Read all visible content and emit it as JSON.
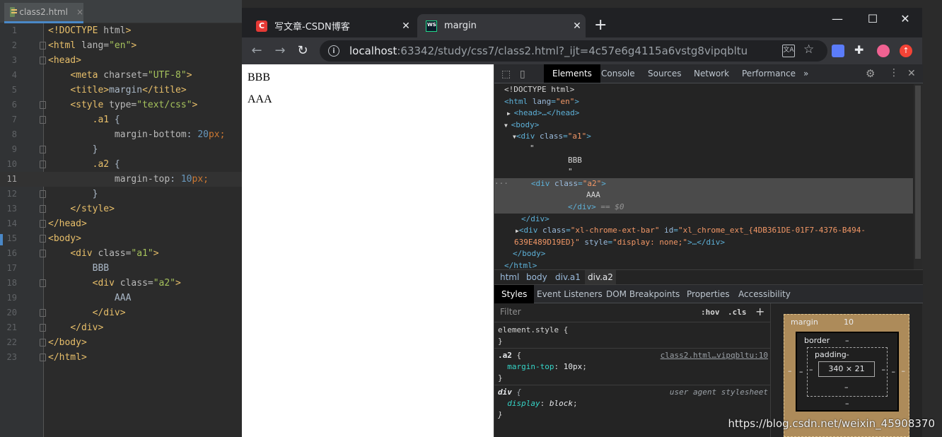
{
  "ide": {
    "tab_label": "class2.html",
    "close_glyph": "×",
    "current_line": 11,
    "lines": [
      {
        "n": "1",
        "segs": [
          [
            "tag",
            "<!DOCTYPE "
          ],
          [
            "attr",
            "html"
          ],
          [
            "tag",
            ">"
          ]
        ]
      },
      {
        "n": "2",
        "segs": [
          [
            "tag",
            "<html "
          ],
          [
            "attr",
            "lang"
          ],
          [
            "attr",
            "="
          ],
          [
            "str",
            "\"en\""
          ],
          [
            "tag",
            ">"
          ]
        ]
      },
      {
        "n": "3",
        "segs": [
          [
            "tag",
            "<head>"
          ]
        ]
      },
      {
        "n": "4",
        "segs": [
          [
            "plain",
            "    "
          ],
          [
            "tag",
            "<meta "
          ],
          [
            "attr",
            "charset"
          ],
          [
            "attr",
            "="
          ],
          [
            "str",
            "\"UTF-8\""
          ],
          [
            "tag",
            ">"
          ]
        ]
      },
      {
        "n": "5",
        "segs": [
          [
            "plain",
            "    "
          ],
          [
            "tag",
            "<title>"
          ],
          [
            "plain",
            "margin"
          ],
          [
            "tag",
            "</title>"
          ]
        ]
      },
      {
        "n": "6",
        "segs": [
          [
            "plain",
            "    "
          ],
          [
            "tag",
            "<style "
          ],
          [
            "attr",
            "type"
          ],
          [
            "attr",
            "="
          ],
          [
            "str",
            "\"text/css\""
          ],
          [
            "tag",
            ">"
          ]
        ]
      },
      {
        "n": "7",
        "segs": [
          [
            "plain",
            "        "
          ],
          [
            "sel",
            ".a1"
          ],
          [
            "plain",
            " {"
          ]
        ]
      },
      {
        "n": "8",
        "segs": [
          [
            "plain",
            "            "
          ],
          [
            "prop",
            "margin-bottom"
          ],
          [
            "plain",
            ": "
          ],
          [
            "num",
            "20"
          ],
          [
            "unit",
            "px"
          ],
          [
            "punc",
            ";"
          ]
        ]
      },
      {
        "n": "9",
        "segs": [
          [
            "plain",
            "        }"
          ]
        ]
      },
      {
        "n": "10",
        "segs": [
          [
            "plain",
            "        "
          ],
          [
            "sel",
            ".a2"
          ],
          [
            "plain",
            " {"
          ]
        ]
      },
      {
        "n": "11",
        "segs": [
          [
            "plain",
            "            "
          ],
          [
            "prop",
            "margin-top"
          ],
          [
            "plain",
            ": "
          ],
          [
            "num",
            "10"
          ],
          [
            "unit",
            "px"
          ],
          [
            "punc",
            ";"
          ]
        ]
      },
      {
        "n": "12",
        "segs": [
          [
            "plain",
            "        }"
          ]
        ]
      },
      {
        "n": "13",
        "segs": [
          [
            "plain",
            "    "
          ],
          [
            "tag",
            "</style>"
          ]
        ]
      },
      {
        "n": "14",
        "segs": [
          [
            "tag",
            "</head>"
          ]
        ]
      },
      {
        "n": "15",
        "segs": [
          [
            "tag",
            "<body>"
          ]
        ]
      },
      {
        "n": "16",
        "segs": [
          [
            "plain",
            "    "
          ],
          [
            "tag",
            "<div "
          ],
          [
            "attr",
            "class"
          ],
          [
            "attr",
            "="
          ],
          [
            "str",
            "\"a1\""
          ],
          [
            "tag",
            ">"
          ]
        ]
      },
      {
        "n": "17",
        "segs": [
          [
            "plain",
            "        BBB"
          ]
        ]
      },
      {
        "n": "18",
        "segs": [
          [
            "plain",
            "        "
          ],
          [
            "tag",
            "<div "
          ],
          [
            "attr",
            "class"
          ],
          [
            "attr",
            "="
          ],
          [
            "str",
            "\"a2\""
          ],
          [
            "tag",
            ">"
          ]
        ]
      },
      {
        "n": "19",
        "segs": [
          [
            "plain",
            "            AAA"
          ]
        ]
      },
      {
        "n": "20",
        "segs": [
          [
            "plain",
            "        "
          ],
          [
            "tag",
            "</div>"
          ]
        ]
      },
      {
        "n": "21",
        "segs": [
          [
            "plain",
            "    "
          ],
          [
            "tag",
            "</div>"
          ]
        ]
      },
      {
        "n": "22",
        "segs": [
          [
            "tag",
            "</body>"
          ]
        ]
      },
      {
        "n": "23",
        "segs": [
          [
            "tag",
            "</html>"
          ]
        ]
      }
    ],
    "fold_lines": [
      2,
      3,
      6,
      7,
      9,
      10,
      12,
      13,
      14,
      15,
      16,
      18,
      20,
      21,
      22,
      23
    ]
  },
  "browser": {
    "tabs": [
      {
        "favicon": "C",
        "title": "写文章-CSDN博客",
        "close": "✕"
      },
      {
        "favicon": "WS",
        "title": "margin",
        "close": "✕"
      }
    ],
    "new_tab": "+",
    "window_controls": {
      "minimize": "—",
      "maximize": "☐",
      "close": "✕"
    },
    "nav": {
      "back": "←",
      "forward": "→",
      "reload": "↻"
    },
    "url_host": "localhost",
    "url_rest": ":63342/study/css7/class2.html?_ijt=4c57e6g4115a6vstg8vipqbltu",
    "info_glyph": "i",
    "translate_glyph": "文A",
    "star_glyph": "☆",
    "puzzle_glyph": "✚",
    "ext_badge": "↑",
    "page": {
      "div_a1_text": "BBB",
      "div_a2_text": "AAA"
    }
  },
  "devtools": {
    "tabs": [
      "Elements",
      "Console",
      "Sources",
      "Network",
      "Performance"
    ],
    "more_glyph": "»",
    "gear_glyph": "⚙",
    "kebab_glyph": "⋮",
    "close_glyph": "✕",
    "inspect_glyph": "⬚",
    "device_glyph": "▯",
    "tree": {
      "doctype": "<!DOCTYPE html>",
      "html_open_tag": "<html ",
      "html_lang_attr": "lang",
      "html_lang_val": "\"en\"",
      "head_line": "<head>…</head>",
      "body_open": "<body>",
      "div_a1_open": "<div ",
      "class_attr": "class",
      "div_a1_class": "\"a1\"",
      "quote_1": "\"",
      "bbb": "BBB",
      "quote_2": "\"",
      "div_a2_class": "\"a2\"",
      "aaa": "AAA",
      "div_close": "</div>",
      "selected_suffix": " == $0",
      "ellipsis": "···",
      "ext_div_open": "<div ",
      "ext_class_val": "\"xl-chrome-ext-bar\"",
      "id_attr": "id",
      "ext_id_val_part1": "\"xl_chrome_ext_{4DB361DE-01F7-4376-B494-",
      "ext_id_val_part2": "639E489D19ED}\"",
      "style_attr": "style",
      "ext_style_val": "\"display: none;\"",
      "ext_tail": ">…</div>",
      "body_close": "</body>",
      "html_close": "</html>"
    },
    "breadcrumbs": [
      "html",
      "body",
      "div.a1",
      "div.a2"
    ],
    "styles_tabs": [
      "Styles",
      "Event Listeners",
      "DOM Breakpoints",
      "Properties",
      "Accessibility"
    ],
    "filter_placeholder": "Filter",
    "hov": ":hov",
    "cls": ".cls",
    "plus": "+",
    "rules": {
      "element_style_selector": "element.style {",
      "close_brace": "}",
      "a2_selector": ".a2",
      "open_brace": " {",
      "a2_source": "class2.html…vipqbltu:10",
      "a2_prop": "margin-top",
      "a2_value": "10px",
      "div_selector": "div",
      "div_source": "user agent stylesheet",
      "div_prop": "display",
      "div_value": "block"
    },
    "box_model": {
      "margin_label": "margin",
      "margin_value": "10",
      "border_label": "border",
      "padding_label": "padding-",
      "content": "340 × 21",
      "dash": "–"
    }
  },
  "watermark": "https://blog.csdn.net/weixin_45908370"
}
